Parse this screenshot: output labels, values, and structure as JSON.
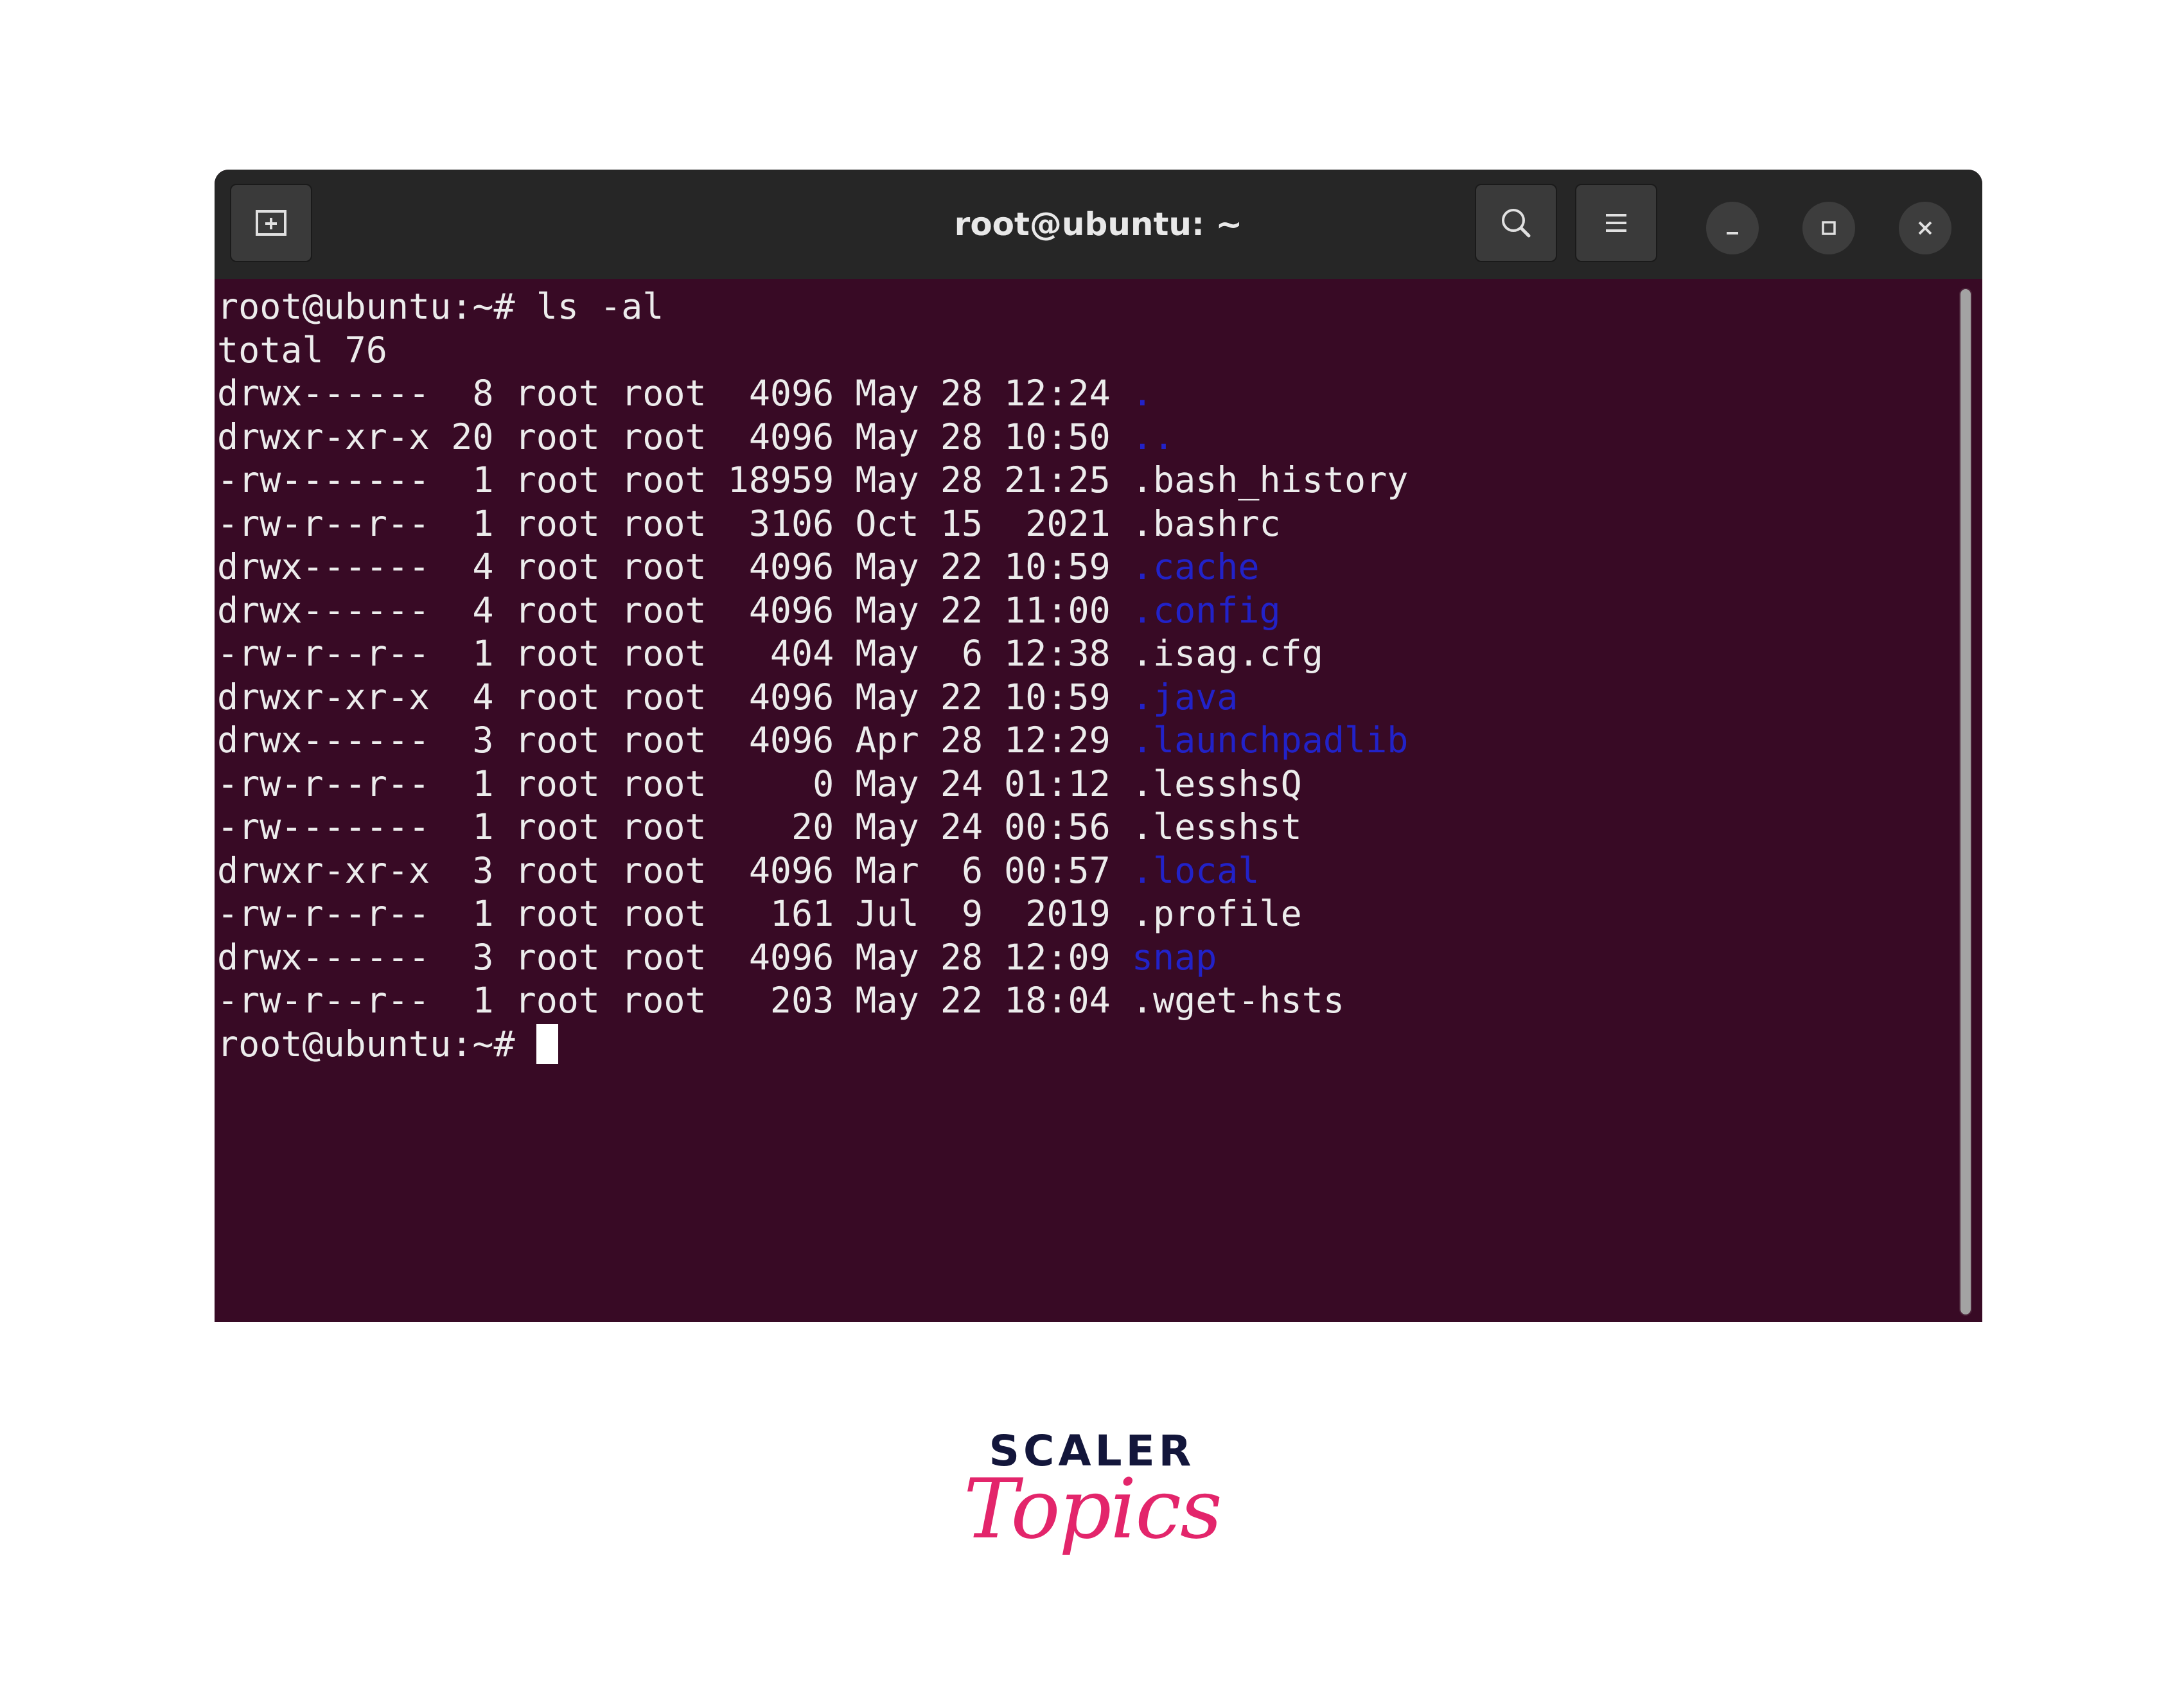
{
  "window": {
    "title": "root@ubuntu: ~"
  },
  "colors": {
    "terminal_background": "#380a25",
    "titlebar_background": "#262626",
    "text": "#ececec",
    "directory": "#2222c8",
    "brand_dark": "#13163b",
    "brand_accent": "#e3256b"
  },
  "icons": {
    "new_tab": "new-tab-icon",
    "search": "search-icon",
    "menu": "hamburger-menu-icon",
    "minimize": "minimize-icon",
    "maximize": "maximize-icon",
    "close": "close-icon"
  },
  "terminal": {
    "command_line": "root@ubuntu:~# ls -al",
    "total_line": "total 76",
    "listing": [
      {
        "prefix": "drwx------  8 root root  4096 May 28 12:24 ",
        "name": ".",
        "is_dir": true
      },
      {
        "prefix": "drwxr-xr-x 20 root root  4096 May 28 10:50 ",
        "name": "..",
        "is_dir": true
      },
      {
        "prefix": "-rw-------  1 root root 18959 May 28 21:25 ",
        "name": ".bash_history",
        "is_dir": false
      },
      {
        "prefix": "-rw-r--r--  1 root root  3106 Oct 15  2021 ",
        "name": ".bashrc",
        "is_dir": false
      },
      {
        "prefix": "drwx------  4 root root  4096 May 22 10:59 ",
        "name": ".cache",
        "is_dir": true
      },
      {
        "prefix": "drwx------  4 root root  4096 May 22 11:00 ",
        "name": ".config",
        "is_dir": true
      },
      {
        "prefix": "-rw-r--r--  1 root root   404 May  6 12:38 ",
        "name": ".isag.cfg",
        "is_dir": false
      },
      {
        "prefix": "drwxr-xr-x  4 root root  4096 May 22 10:59 ",
        "name": ".java",
        "is_dir": true
      },
      {
        "prefix": "drwx------  3 root root  4096 Apr 28 12:29 ",
        "name": ".launchpadlib",
        "is_dir": true
      },
      {
        "prefix": "-rw-r--r--  1 root root     0 May 24 01:12 ",
        "name": ".lesshsQ",
        "is_dir": false
      },
      {
        "prefix": "-rw-------  1 root root    20 May 24 00:56 ",
        "name": ".lesshst",
        "is_dir": false
      },
      {
        "prefix": "drwxr-xr-x  3 root root  4096 Mar  6 00:57 ",
        "name": ".local",
        "is_dir": true
      },
      {
        "prefix": "-rw-r--r--  1 root root   161 Jul  9  2019 ",
        "name": ".profile",
        "is_dir": false
      },
      {
        "prefix": "drwx------  3 root root  4096 May 28 12:09 ",
        "name": "snap",
        "is_dir": true
      },
      {
        "prefix": "-rw-r--r--  1 root root   203 May 22 18:04 ",
        "name": ".wget-hsts",
        "is_dir": false
      }
    ],
    "prompt": "root@ubuntu:~# "
  },
  "brand": {
    "name": "SCALER",
    "sub": "Topics"
  }
}
